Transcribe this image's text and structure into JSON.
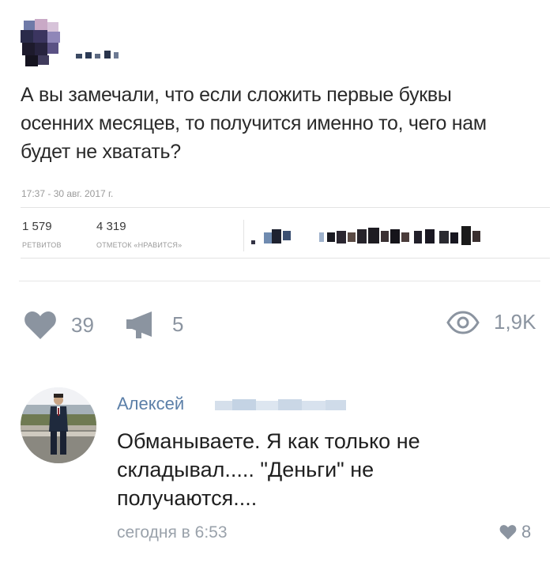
{
  "tweet": {
    "text": "А вы замечали, что если сложить первые буквы осенних месяцев, то получится именно то, чего нам будет не хватать?",
    "timestamp": "17:37 - 30 авг. 2017 г.",
    "retweets": {
      "count": "1 579",
      "label": "РЕТВИТОВ"
    },
    "likes": {
      "count": "4 319",
      "label": "ОТМЕТОК «НРАВИТСЯ»"
    }
  },
  "post_actions": {
    "likes": "39",
    "reposts": "5",
    "views": "1,9K",
    "icons": [
      "heart-icon",
      "megaphone-icon",
      "eye-icon"
    ]
  },
  "comment": {
    "author_first_name": "Алексей",
    "text": "Обманываете. Я как только не складывал..... \"Деньги\" не получаются....",
    "time": "сегодня в 6:53",
    "likes": "8"
  },
  "colors": {
    "author": "#5b7fa8",
    "icon_gray": "#8b94a0",
    "muted_text": "#9aa2ab"
  }
}
